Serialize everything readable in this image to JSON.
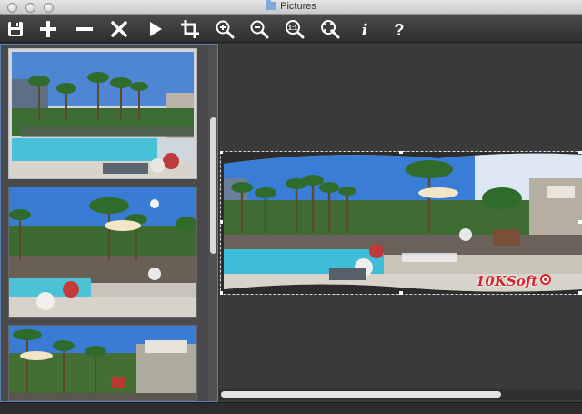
{
  "window": {
    "title": "Pictures",
    "folder_icon": "folder-icon"
  },
  "toolbar": {
    "buttons": [
      {
        "name": "save-button",
        "icon": "floppy-disk-icon"
      },
      {
        "name": "add-button",
        "icon": "plus-icon"
      },
      {
        "name": "remove-button",
        "icon": "minus-icon"
      },
      {
        "name": "delete-button",
        "icon": "x-icon"
      },
      {
        "name": "play-button",
        "icon": "play-icon"
      },
      {
        "name": "crop-button",
        "icon": "crop-icon"
      },
      {
        "name": "zoom-in-button",
        "icon": "zoom-in-icon"
      },
      {
        "name": "zoom-out-button",
        "icon": "zoom-out-icon"
      },
      {
        "name": "actual-size-button",
        "icon": "zoom-actual-size-icon"
      },
      {
        "name": "zoom-fit-button",
        "icon": "zoom-fit-icon"
      },
      {
        "name": "info-button",
        "icon": "info-icon"
      },
      {
        "name": "help-button",
        "icon": "help-icon"
      }
    ],
    "actual_size_text": "1:1",
    "info_text": "i",
    "help_text": "?"
  },
  "sidebar": {
    "thumbnails": [
      {
        "name": "pool-party-photo-1",
        "selected": true
      },
      {
        "name": "pool-party-photo-2",
        "selected": false
      },
      {
        "name": "pool-party-photo-3",
        "selected": false
      }
    ]
  },
  "main": {
    "panorama": "stitched-panorama-preview",
    "watermark_text": "10KSoft"
  },
  "colors": {
    "accent": "#5b7fb5",
    "toolbar_bg": "#3a3a3c",
    "watermark": "#d8232a"
  }
}
